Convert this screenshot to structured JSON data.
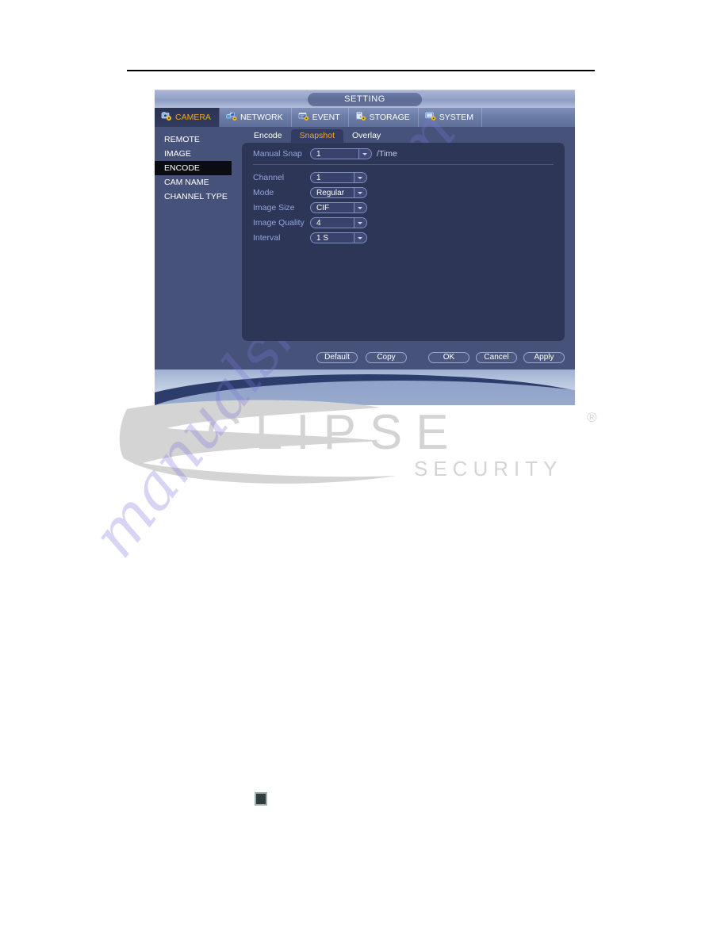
{
  "window": {
    "title": "SETTING"
  },
  "nav": {
    "items": [
      {
        "label": "CAMERA",
        "icon": "camera-gear-icon",
        "active": true
      },
      {
        "label": "NETWORK",
        "icon": "network-gear-icon",
        "active": false
      },
      {
        "label": "EVENT",
        "icon": "event-gear-icon",
        "active": false
      },
      {
        "label": "STORAGE",
        "icon": "storage-gear-icon",
        "active": false
      },
      {
        "label": "SYSTEM",
        "icon": "system-gear-icon",
        "active": false
      }
    ]
  },
  "sidebar": {
    "items": [
      {
        "label": "REMOTE",
        "active": false
      },
      {
        "label": "IMAGE",
        "active": false
      },
      {
        "label": "ENCODE",
        "active": true
      },
      {
        "label": "CAM NAME",
        "active": false
      },
      {
        "label": "CHANNEL TYPE",
        "active": false
      }
    ]
  },
  "subtabs": {
    "items": [
      {
        "label": "Encode",
        "active": false
      },
      {
        "label": "Snapshot",
        "active": true
      },
      {
        "label": "Overlay",
        "active": false
      }
    ]
  },
  "form": {
    "manual_snap": {
      "label": "Manual Snap",
      "value": "1",
      "suffix": "/Time"
    },
    "channel": {
      "label": "Channel",
      "value": "1"
    },
    "mode": {
      "label": "Mode",
      "value": "Regular"
    },
    "image_size": {
      "label": "Image Size",
      "value": "CIF"
    },
    "image_quality": {
      "label": "Image Quality",
      "value": "4"
    },
    "interval": {
      "label": "Interval",
      "value": "1 S"
    }
  },
  "footer": {
    "default_label": "Default",
    "copy_label": "Copy",
    "ok_label": "OK",
    "cancel_label": "Cancel",
    "apply_label": "Apply"
  },
  "watermarks": {
    "brand_name": "CLIPSE",
    "brand_sub": "SECURITY",
    "brand_mark": "®",
    "site": "manualshive.com"
  },
  "colors": {
    "accent_orange": "#f2a81c",
    "panel_navy": "#2e3658",
    "sidebar_blue": "#47527a",
    "label_blue": "#93a5dc"
  }
}
